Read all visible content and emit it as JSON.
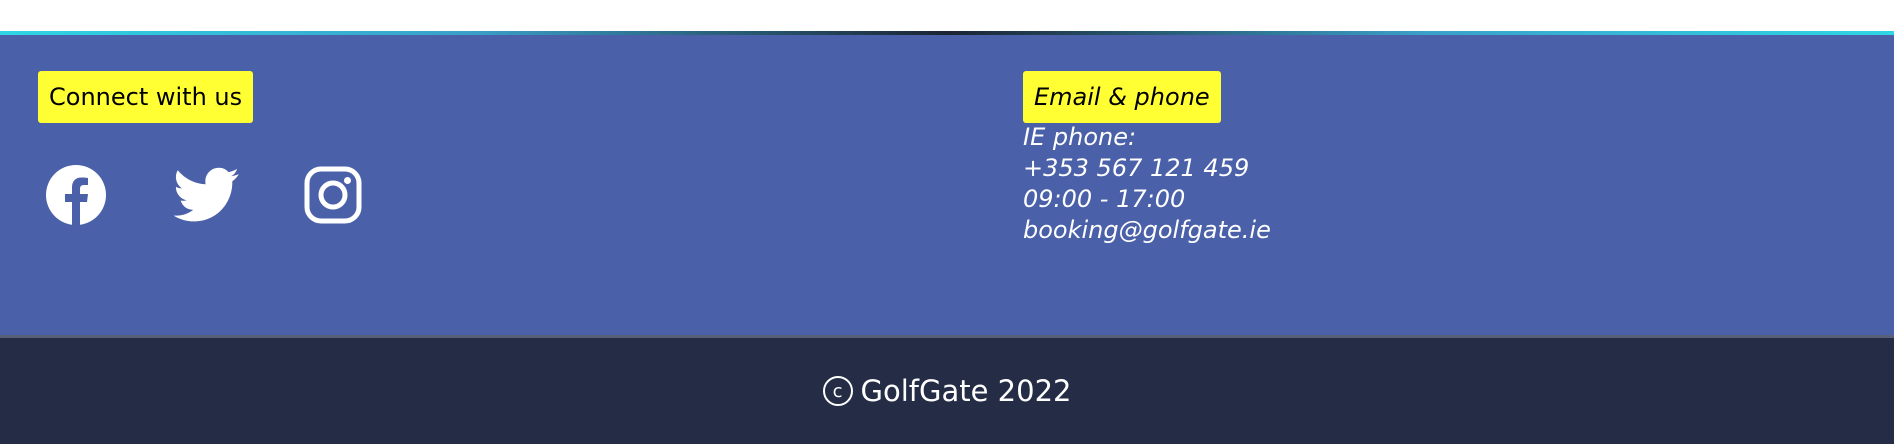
{
  "connect": {
    "heading": "Connect with us",
    "social_icons": [
      "facebook-icon",
      "twitter-icon",
      "instagram-icon"
    ]
  },
  "contact": {
    "heading": "Email & phone",
    "phone_label": "IE phone:",
    "phone_number": "+353 567 121 459",
    "hours": "09:00 - 17:00",
    "email": "booking@golfgate.ie"
  },
  "footer": {
    "copyright_symbol": "c",
    "copyright_text": "GolfGate 2022"
  },
  "colors": {
    "footer_blue": "#4a60a8",
    "footer_dark": "#242d45",
    "badge_yellow": "#ffff33",
    "accent_cyan": "#2fd6e6"
  }
}
